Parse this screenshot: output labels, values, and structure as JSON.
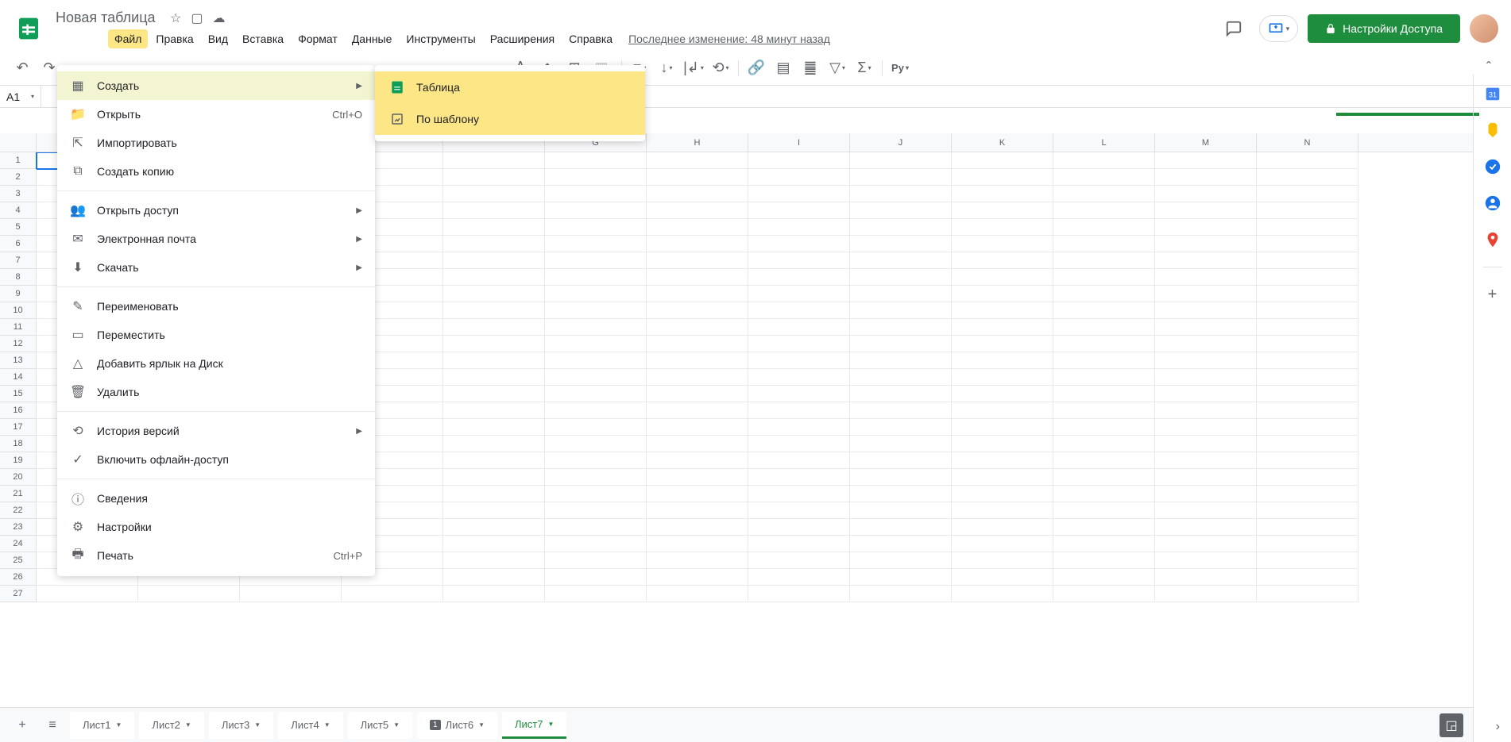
{
  "header": {
    "doc_title": "Новая таблица",
    "share_label": "Настройки Доступа"
  },
  "menubar": {
    "items": [
      "Файл",
      "Правка",
      "Вид",
      "Вставка",
      "Формат",
      "Данные",
      "Инструменты",
      "Расширения",
      "Справка"
    ],
    "active_index": 0,
    "last_change": "Последнее изменение: 48 минут назад"
  },
  "name_box": "A1",
  "file_menu": {
    "items": [
      {
        "icon": "sheet",
        "label": "Создать",
        "arrow": true,
        "highlight": true
      },
      {
        "icon": "folder",
        "label": "Открыть",
        "shortcut": "Ctrl+O"
      },
      {
        "icon": "import",
        "label": "Импортировать"
      },
      {
        "icon": "copy",
        "label": "Создать копию"
      },
      {
        "sep": true
      },
      {
        "icon": "share",
        "label": "Открыть доступ",
        "arrow": true
      },
      {
        "icon": "mail",
        "label": "Электронная почта",
        "arrow": true
      },
      {
        "icon": "download",
        "label": "Скачать",
        "arrow": true
      },
      {
        "sep": true
      },
      {
        "icon": "rename",
        "label": "Переименовать"
      },
      {
        "icon": "move",
        "label": "Переместить"
      },
      {
        "icon": "drive",
        "label": "Добавить ярлык на Диск"
      },
      {
        "icon": "trash",
        "label": "Удалить"
      },
      {
        "sep": true
      },
      {
        "icon": "history",
        "label": "История версий",
        "arrow": true
      },
      {
        "icon": "offline",
        "label": "Включить офлайн-доступ"
      },
      {
        "sep": true
      },
      {
        "icon": "info",
        "label": "Сведения"
      },
      {
        "icon": "settings",
        "label": "Настройки"
      },
      {
        "icon": "print",
        "label": "Печать",
        "shortcut": "Ctrl+P"
      }
    ]
  },
  "create_submenu": {
    "items": [
      {
        "icon": "sheets",
        "label": "Таблица",
        "highlight": true
      },
      {
        "icon": "template",
        "label": "По шаблону",
        "highlight": true
      }
    ]
  },
  "columns": [
    "G",
    "H",
    "I",
    "J",
    "K",
    "L",
    "M",
    "N"
  ],
  "row_count": 27,
  "sheet_tabs": [
    {
      "label": "Лист1"
    },
    {
      "label": "Лист2"
    },
    {
      "label": "Лист3"
    },
    {
      "label": "Лист4"
    },
    {
      "label": "Лист5"
    },
    {
      "label": "Лист6",
      "badge": "1"
    },
    {
      "label": "Лист7",
      "active": true
    }
  ],
  "toolbar_right_label": "Рy"
}
